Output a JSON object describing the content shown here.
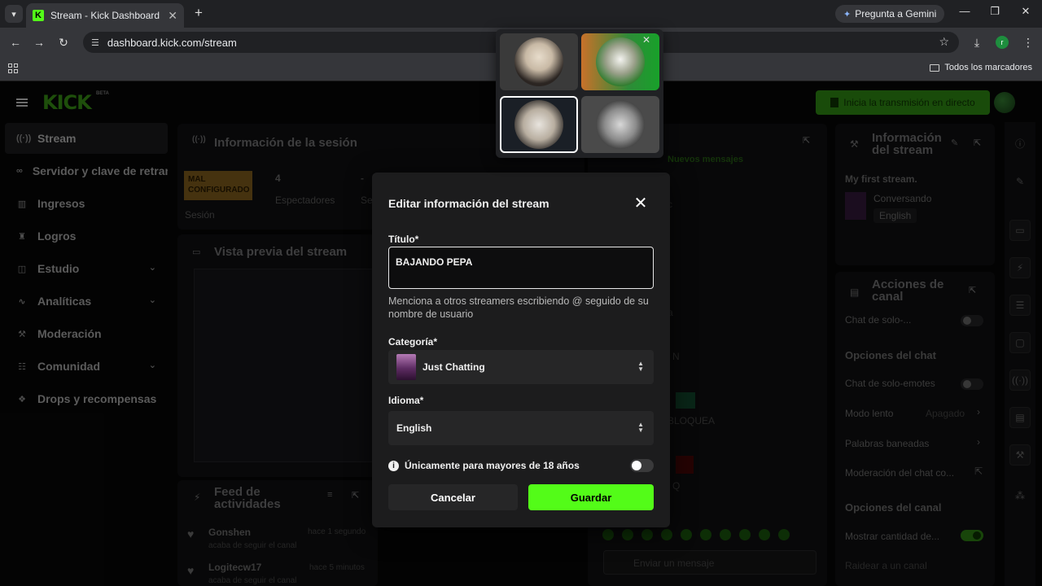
{
  "browser": {
    "tab_title": "Stream - Kick Dashboard",
    "url": "dashboard.kick.com/stream",
    "gemini_label": "Pregunta a Gemini",
    "all_bookmarks": "Todos los marcadores",
    "profile_initial": "r"
  },
  "header": {
    "logo": "KICK",
    "beta": "BETA",
    "go_live": "Inicia la transmisión en directo"
  },
  "sidebar": {
    "items": [
      {
        "label": "Stream"
      },
      {
        "label": "Servidor y clave de retransmisión"
      },
      {
        "label": "Ingresos"
      },
      {
        "label": "Logros"
      },
      {
        "label": "Estudio"
      },
      {
        "label": "Analíticas"
      },
      {
        "label": "Moderación"
      },
      {
        "label": "Comunidad"
      },
      {
        "label": "Drops y recompensas"
      }
    ]
  },
  "session": {
    "title": "Información de la sesión",
    "status": "MAL CONFIGURADO",
    "status_label": "Sesión",
    "viewers": "4",
    "viewers_label": "Espectadores",
    "dash": "-",
    "dash_label": "Se"
  },
  "preview": {
    "title": "Vista previa del stream"
  },
  "feed": {
    "title": "Feed de actividades",
    "items": [
      {
        "user": "Gonshen",
        "time": "hace 1 segundo",
        "action": "acaba de seguir el canal"
      },
      {
        "user": "Logitecw17",
        "time": "hace 5 minutos",
        "action": "acaba de seguir el canal"
      }
    ]
  },
  "chat": {
    "new_messages": "Nuevos mensajes",
    "placeholder": "Enviar un mensaje",
    "fragments": [
      "c",
      "a",
      "N",
      "BLOQUEA",
      "Q"
    ]
  },
  "stream_info": {
    "title": "Información del stream",
    "stream_title": "My first stream.",
    "category": "Conversando",
    "language": "English"
  },
  "channel_actions": {
    "title": "Acciones de canal",
    "chat_solo": "Chat de solo-...",
    "chat_options": "Opciones del chat",
    "emotes_only": "Chat de solo-emotes",
    "slow_mode": "Modo lento",
    "slow_mode_value": "Apagado",
    "banned_words": "Palabras baneadas",
    "chat_moderation": "Moderación del chat co...",
    "channel_options": "Opciones del canal",
    "show_count": "Mostrar cantidad de...",
    "raid": "Raidear a un canal"
  },
  "modal": {
    "heading": "Editar información del stream",
    "title_label": "Título*",
    "title_value": "BAJANDO PEPA",
    "hint": "Menciona a otros streamers escribiendo @ seguido de su nombre de usuario",
    "category_label": "Categoría*",
    "category_value": "Just Chatting",
    "language_label": "Idioma*",
    "language_value": "English",
    "adult_label": "Únicamente para mayores de 18 años",
    "adult_on": false,
    "cancel": "Cancelar",
    "save": "Guardar"
  },
  "colors": {
    "kick_green": "#53fc18",
    "modal_bg": "#1c1c1d",
    "warning": "#6b4e17"
  }
}
